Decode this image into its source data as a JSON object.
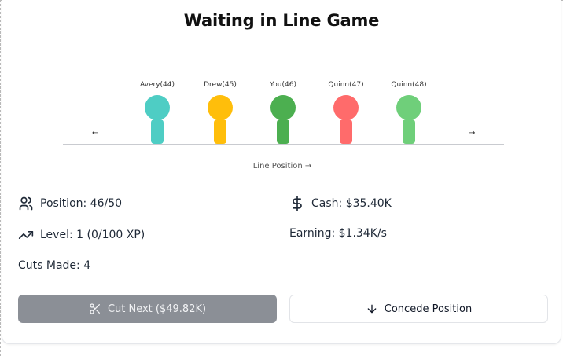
{
  "title": "Waiting in Line Game",
  "line": {
    "left_arrow": "←",
    "right_arrow": "→",
    "axis_label": "Line Position →",
    "people": [
      {
        "name": "Avery(44)",
        "color": "#4ecdc4"
      },
      {
        "name": "Drew(45)",
        "color": "#ffbe0b"
      },
      {
        "name": "You(46)",
        "color": "#4caf50"
      },
      {
        "name": "Quinn(47)",
        "color": "#ff6b6b"
      },
      {
        "name": "Quinn(48)",
        "color": "#6fcf7a"
      }
    ]
  },
  "stats": {
    "position": "Position: 46/50",
    "level": "Level: 1 (0/100 XP)",
    "cuts": "Cuts Made: 4",
    "cash": "Cash: $35.40K",
    "earning": "Earning: $1.34K/s"
  },
  "buttons": {
    "cut_next": "Cut Next ($49.82K)",
    "concede": "Concede Position"
  },
  "icons": {
    "position": "users-icon",
    "level": "trending-up-icon",
    "cash": "dollar-icon",
    "cut": "scissors-icon",
    "concede": "arrow-down-icon"
  }
}
